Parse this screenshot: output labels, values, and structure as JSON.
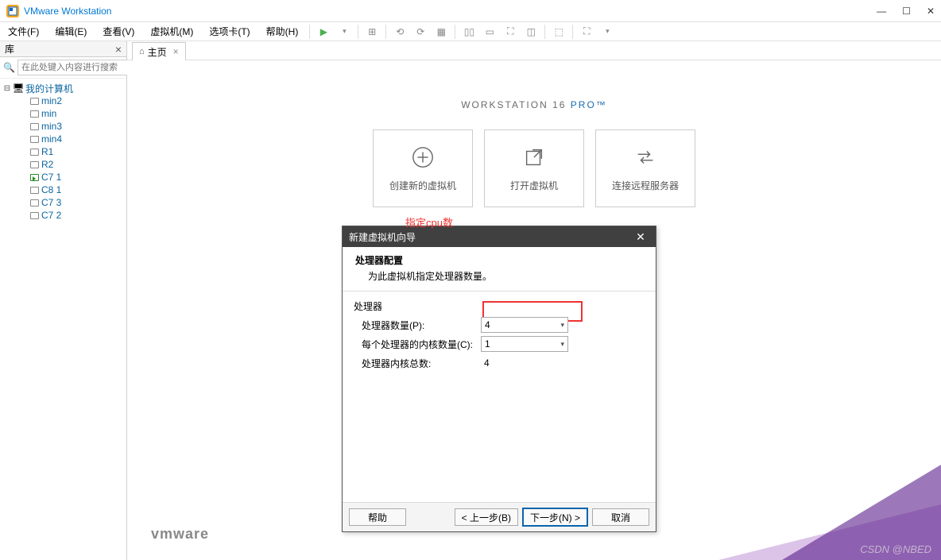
{
  "app": {
    "title": "VMware Workstation"
  },
  "menu": {
    "items": [
      "文件(F)",
      "编辑(E)",
      "查看(V)",
      "虚拟机(M)",
      "选项卡(T)",
      "帮助(H)"
    ]
  },
  "sidebar": {
    "title": "库",
    "search_placeholder": "在此处键入内容进行搜索",
    "root": "我的计算机",
    "vms": [
      "min2",
      "min",
      "min3",
      "min4",
      "R1",
      "R2",
      "C7 1",
      "C8 1",
      "C7 3",
      "C7 2"
    ],
    "active_index": 6
  },
  "tab": {
    "label": "主页"
  },
  "hero": {
    "prefix": "WORKSTATION 16 ",
    "suffix": "PRO™"
  },
  "cards": {
    "create": "创建新的虚拟机",
    "open": "打开虚拟机",
    "connect": "连接远程服务器"
  },
  "dialog": {
    "title": "新建虚拟机向导",
    "heading": "处理器配置",
    "subheading": "为此虚拟机指定处理器数量。",
    "group": "处理器",
    "proc_count_label": "处理器数量(P):",
    "proc_count_value": "4",
    "cores_label": "每个处理器的内核数量(C):",
    "cores_value": "1",
    "total_label": "处理器内核总数:",
    "total_value": "4",
    "help": "帮助",
    "back": "< 上一步(B)",
    "next": "下一步(N) >",
    "cancel": "取消"
  },
  "annotation": "指定cpu数",
  "footer": {
    "brand": "vmware",
    "watermark": "CSDN @NBED"
  }
}
